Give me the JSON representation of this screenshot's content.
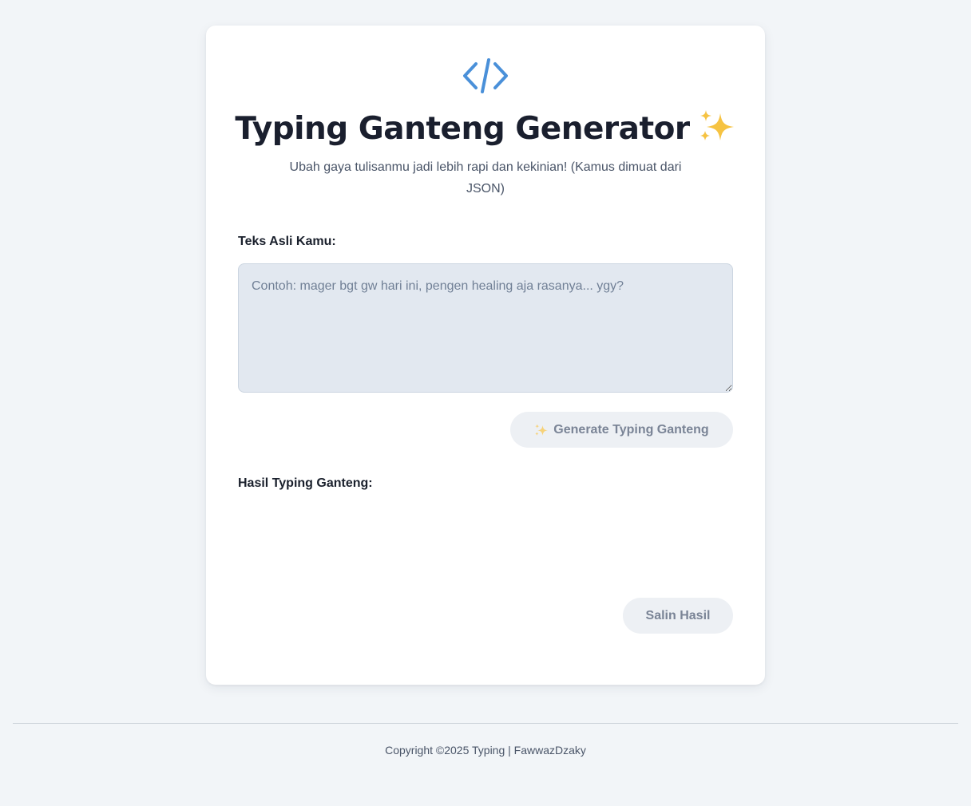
{
  "header": {
    "logo_icon": "code-icon",
    "title": "Typing Ganteng Generator",
    "title_icon": "sparkles-icon",
    "subtitle": "Ubah gaya tulisanmu jadi lebih rapi dan kekinian! (Kamus dimuat dari JSON)"
  },
  "input": {
    "label": "Teks Asli Kamu:",
    "value": "",
    "placeholder": "Contoh: mager bgt gw hari ini, pengen healing aja rasanya... ygy?"
  },
  "generate_button": {
    "icon": "sparkles-icon",
    "label": "Generate Typing Ganteng"
  },
  "result": {
    "label": "Hasil Typing Ganteng:",
    "value": ""
  },
  "copy_button": {
    "label": "Salin Hasil"
  },
  "footer": {
    "text": "Copyright ©2025 Typing | FawwazDzaky"
  },
  "colors": {
    "background": "#f2f5f8",
    "card": "#ffffff",
    "accent": "#4a90d9",
    "title": "#1a1f2e",
    "input_bg": "#e2e8f0",
    "button_bg": "#edf0f4",
    "button_text": "#7a8496",
    "sparkle": "#f6c342"
  }
}
